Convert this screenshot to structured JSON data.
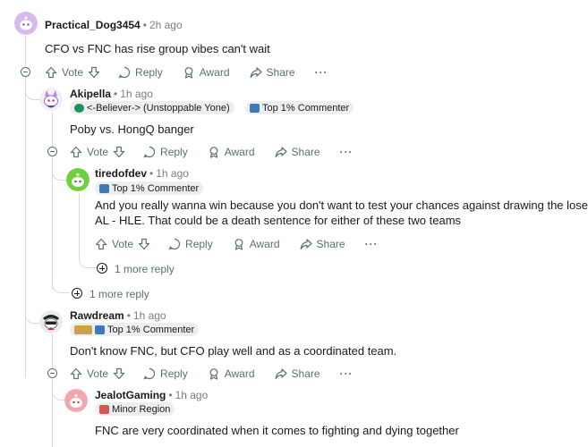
{
  "comments": {
    "c1": {
      "author": "Practical_Dog3454",
      "time": "2h ago",
      "body": "CFO vs FNC has rise group vibes can't wait"
    },
    "c2": {
      "author": "Akipella",
      "time": "1h ago",
      "flair_user": "<-Believer-> (Unstoppable Yone)",
      "flair_badge": "Top 1% Commenter",
      "body": "Poby vs. HongQ banger"
    },
    "c3": {
      "author": "tiredofdev",
      "time": "1h ago",
      "flair_badge": "Top 1% Commenter",
      "body_line1": "And you really wanna win because you don't want to test your chances against drawing the loser of",
      "body_line2": "AL - HLE. That could be a death sentence for either of these two teams"
    },
    "c4": {
      "author": "Rawdream",
      "time": "1h ago",
      "flair_badge": "Top 1% Commenter",
      "body": "Don't know FNC, but CFO play well and as a coordinated team."
    },
    "c5": {
      "author": "JealotGaming",
      "time": "1h ago",
      "flair_user": "Minor Region",
      "body": "FNC are very coordinated when it comes to fighting and dying together"
    }
  },
  "actions": {
    "vote": "Vote",
    "reply": "Reply",
    "award": "Award",
    "share": "Share",
    "more": "···"
  },
  "more_replies": {
    "tiredofdev": "1 more reply",
    "akipella": "1 more reply"
  },
  "separator": "•",
  "colors": {
    "text": "#1a1a1b",
    "meta": "#7c7c7c",
    "action": "#576f76",
    "thread_line": "#d7dadc",
    "flair_bg": "#eceef0"
  }
}
